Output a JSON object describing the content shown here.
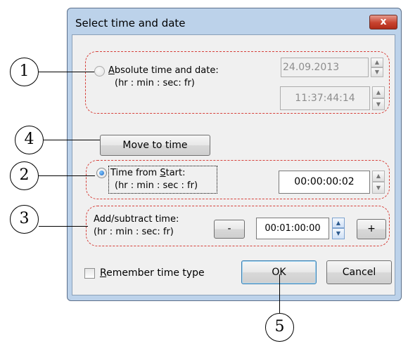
{
  "dialog": {
    "title": "Select time and date",
    "close_label": "x"
  },
  "absolute": {
    "label": "Absolute time and date:",
    "hint": "(hr : min : sec: fr)",
    "date_value": "24.09.2013",
    "time_value": "11:37:44:14",
    "selected": false,
    "enabled": false
  },
  "move_to_time": {
    "label": "Move to time"
  },
  "from_start": {
    "label": "Time from Start:",
    "hint": "(hr : min : sec : fr)",
    "value": "00:00:00:02",
    "selected": true
  },
  "add_subtract": {
    "label": "Add/subtract time:",
    "hint": "(hr : min : sec: fr)",
    "minus_label": "-",
    "value": "00:01:00:00",
    "plus_label": "+"
  },
  "footer": {
    "remember_label": "Remember time type",
    "remember_checked": false,
    "ok_label": "OK",
    "cancel_label": "Cancel"
  },
  "callouts": [
    "1",
    "2",
    "3",
    "4",
    "5"
  ],
  "colors": {
    "annotation_dash": "#d6403a",
    "titlebar": "#bcd2ea",
    "close_button": "#c8432f",
    "radio_selected": "#1f67c2"
  }
}
